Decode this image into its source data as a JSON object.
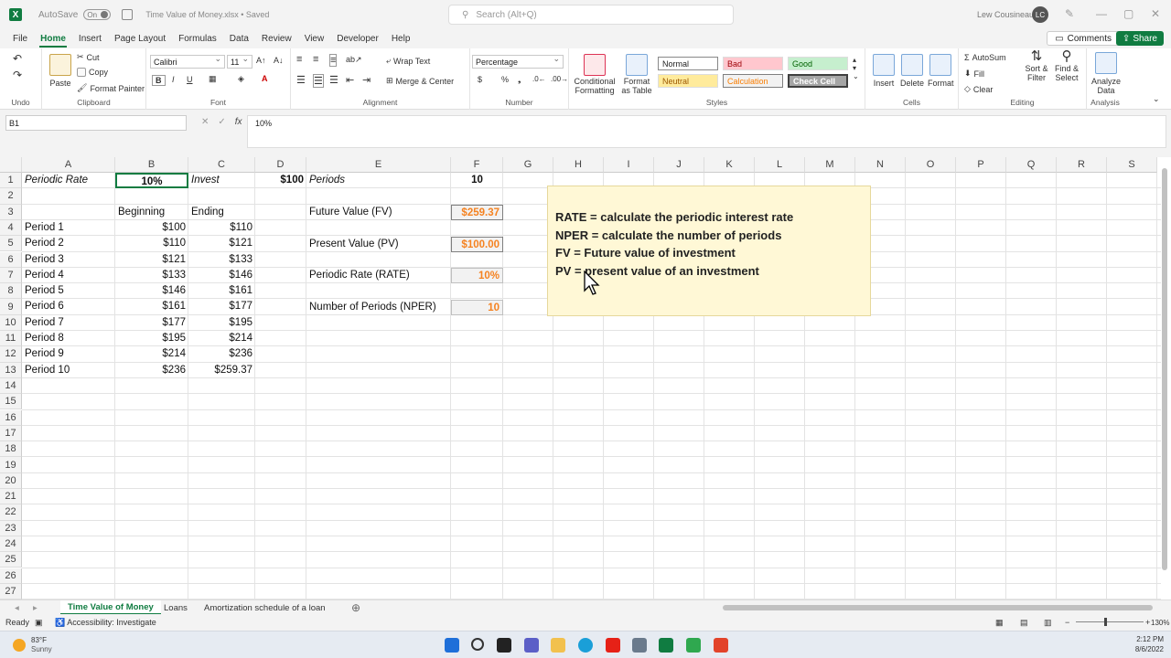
{
  "titlebar": {
    "app_icon": "X",
    "autosave_label": "AutoSave",
    "autosave_state": "On",
    "doc_title": "Time Value of Money.xlsx • Saved",
    "search_placeholder": "Search (Alt+Q)",
    "user_name": "Lew Cousineau",
    "user_initials": "LC"
  },
  "ribbon_tabs": [
    "File",
    "Home",
    "Insert",
    "Page Layout",
    "Formulas",
    "Data",
    "Review",
    "View",
    "Developer",
    "Help"
  ],
  "active_tab": "Home",
  "comments_label": "Comments",
  "share_label": "Share",
  "ribbon": {
    "undo_group": "Undo",
    "clipboard": {
      "label": "Clipboard",
      "paste": "Paste",
      "cut": "Cut",
      "copy": "Copy",
      "format_painter": "Format Painter"
    },
    "font": {
      "label": "Font",
      "name": "Calibri",
      "size": "11",
      "bold": "B",
      "italic": "I",
      "underline": "U"
    },
    "alignment": {
      "label": "Alignment",
      "wrap": "Wrap Text",
      "merge": "Merge & Center"
    },
    "number": {
      "label": "Number",
      "format": "Percentage"
    },
    "styles": {
      "label": "Styles",
      "conditional": "Conditional Formatting",
      "format_table": "Format as Table",
      "cells": [
        {
          "name": "Normal",
          "bg": "#ffffff",
          "fg": "#222222"
        },
        {
          "name": "Bad",
          "bg": "#ffc7ce",
          "fg": "#9c0006"
        },
        {
          "name": "Good",
          "bg": "#c6efce",
          "fg": "#006100"
        },
        {
          "name": "Neutral",
          "bg": "#ffeb9c",
          "fg": "#9c5700"
        },
        {
          "name": "Calculation",
          "bg": "#f2f2f2",
          "fg": "#fa7d00"
        },
        {
          "name": "Check Cell",
          "bg": "#a5a5a5",
          "fg": "#ffffff"
        }
      ]
    },
    "cells": {
      "label": "Cells",
      "insert": "Insert",
      "delete": "Delete",
      "format": "Format"
    },
    "editing": {
      "label": "Editing",
      "autosum": "AutoSum",
      "fill": "Fill",
      "clear": "Clear",
      "sort": "Sort & Filter",
      "find": "Find & Select"
    },
    "analysis": {
      "label": "Analysis",
      "analyze": "Analyze Data"
    }
  },
  "formula_bar": {
    "name_box": "B1",
    "fx": "fx",
    "value": "10%"
  },
  "columns": [
    "A",
    "B",
    "C",
    "D",
    "E",
    "F",
    "G",
    "H",
    "I",
    "J",
    "K",
    "L",
    "M",
    "N",
    "O",
    "P",
    "Q",
    "R",
    "S"
  ],
  "rows": [
    "1",
    "2",
    "3",
    "4",
    "5",
    "6",
    "7",
    "8",
    "9",
    "10",
    "11",
    "12",
    "13",
    "14",
    "15",
    "16",
    "17",
    "18",
    "19",
    "20",
    "21",
    "22",
    "23",
    "24",
    "25",
    "26",
    "27"
  ],
  "sheet": {
    "a1": "Periodic Rate",
    "b1": "10%",
    "c1": "Invest",
    "d1": "$100",
    "e1": "Periods",
    "f1": "10",
    "b3": "Beginning",
    "c3": "Ending",
    "periods": [
      {
        "label": "Period 1",
        "begin": "$100",
        "end": "$110"
      },
      {
        "label": "Period 2",
        "begin": "$110",
        "end": "$121"
      },
      {
        "label": "Period 3",
        "begin": "$121",
        "end": "$133"
      },
      {
        "label": "Period 4",
        "begin": "$133",
        "end": "$146"
      },
      {
        "label": "Period 5",
        "begin": "$146",
        "end": "$161"
      },
      {
        "label": "Period 6",
        "begin": "$161",
        "end": "$177"
      },
      {
        "label": "Period 7",
        "begin": "$177",
        "end": "$195"
      },
      {
        "label": "Period 8",
        "begin": "$195",
        "end": "$214"
      },
      {
        "label": "Period 9",
        "begin": "$214",
        "end": "$236"
      },
      {
        "label": "Period 10",
        "begin": "$236",
        "end": "$259.37"
      }
    ],
    "fv_label": "Future Value (FV)",
    "fv_value": "$259.37",
    "pv_label": "Present Value (PV)",
    "pv_value": "$100.00",
    "rate_label": "Periodic Rate (RATE)",
    "rate_value": "10%",
    "nper_label": "Number of Periods (NPER)",
    "nper_value": "10"
  },
  "note": [
    "RATE = calculate the periodic interest rate",
    "NPER = calculate the number of periods",
    "FV = Future value of investment",
    "PV = present value of an investment"
  ],
  "sheet_tabs": [
    "Time Value of Money",
    "Loans",
    "Amortization schedule of a loan"
  ],
  "status": {
    "ready": "Ready",
    "accessibility": "Accessibility: Investigate",
    "zoom": "130%"
  },
  "taskbar": {
    "temp": "83°F",
    "weather": "Sunny",
    "time": "2:12 PM",
    "date": "8/6/2022"
  }
}
